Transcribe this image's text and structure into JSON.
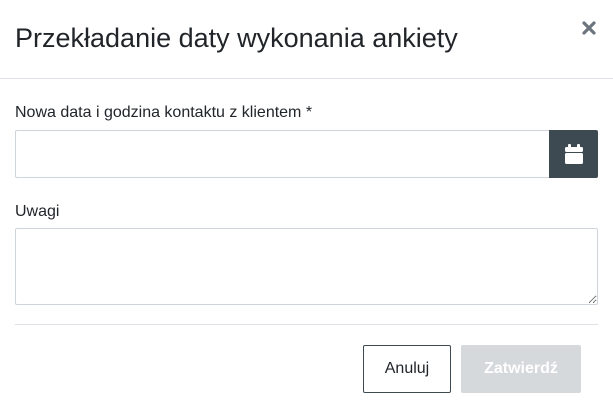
{
  "dialog": {
    "title": "Przekładanie daty wykonania ankiety",
    "close_icon": "close-icon"
  },
  "form": {
    "date_field": {
      "label": "Nowa data i godzina kontaktu z klientem *",
      "value": "",
      "button_icon": "calendar-icon"
    },
    "notes_field": {
      "label": "Uwagi",
      "value": ""
    }
  },
  "footer": {
    "cancel_label": "Anuluj",
    "confirm_label": "Zatwierdź",
    "confirm_disabled": true
  },
  "colors": {
    "calendar_button_bg": "#3e4a52",
    "confirm_disabled_bg": "#d6d9dc",
    "border": "#ced4da"
  }
}
